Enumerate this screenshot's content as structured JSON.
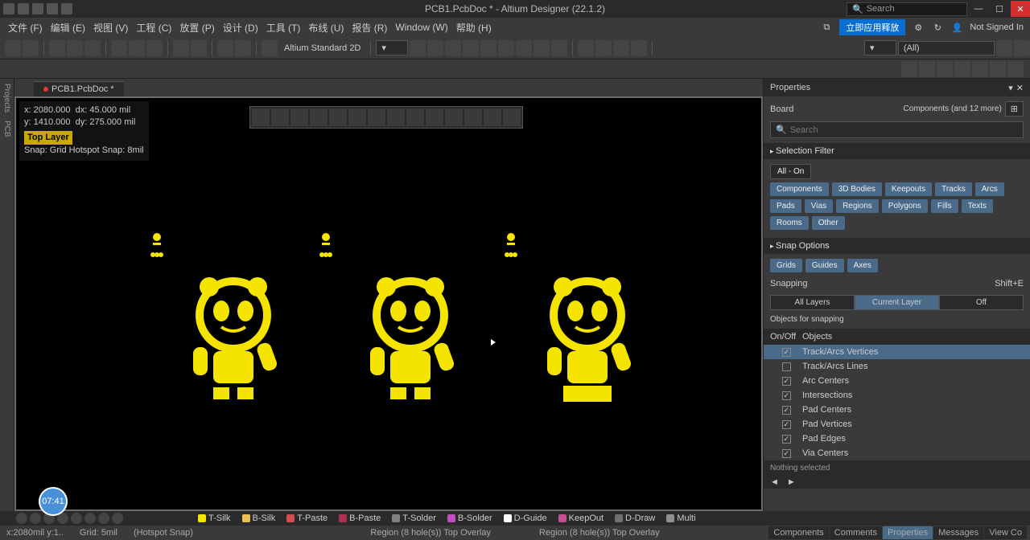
{
  "titlebar": {
    "title": "PCB1.PcbDoc * - Altium Designer (22.1.2)",
    "search_placeholder": "Search"
  },
  "menubar": {
    "items": [
      "文件 (F)",
      "编辑 (E)",
      "视图 (V)",
      "工程 (C)",
      "放置 (P)",
      "设计 (D)",
      "工具 (T)",
      "布线 (U)",
      "报告 (R)",
      "Window (W)",
      "帮助 (H)"
    ],
    "banner": "立即应用释放",
    "signin": "Not Signed In"
  },
  "toolbar": {
    "view_mode": "Altium Standard 2D",
    "net_filter": "(All)"
  },
  "doc_tab": "PCB1.PcbDoc *",
  "coords": {
    "x_label": "x:",
    "x_val": "2080.000",
    "dx_label": "dx:",
    "dx_val": "45.000 mil",
    "y_label": "y:",
    "y_val": "1410.000",
    "dy_label": "dy:",
    "dy_val": "275.000 mil",
    "layer": "Top Layer",
    "snap_info": "Snap: Grid Hotspot Snap: 8mil"
  },
  "properties": {
    "title": "Properties",
    "object_type": "Board",
    "object_filter": "Components (and 12 more)",
    "search_placeholder": "Search",
    "selection_filter": {
      "title": "Selection Filter",
      "all_on": "All - On",
      "pills": [
        "Components",
        "3D Bodies",
        "Keepouts",
        "Tracks",
        "Arcs",
        "Pads",
        "Vias",
        "Regions",
        "Polygons",
        "Fills",
        "Texts",
        "Rooms",
        "Other"
      ]
    },
    "snap_options": {
      "title": "Snap Options",
      "pills": [
        "Grids",
        "Guides",
        "Axes"
      ],
      "snapping_label": "Snapping",
      "snapping_shortcut": "Shift+E",
      "segs": [
        "All Layers",
        "Current Layer",
        "Off"
      ],
      "active_seg": 1,
      "objects_label": "Objects for snapping",
      "col_onoff": "On/Off",
      "col_objects": "Objects",
      "rows": [
        {
          "on": true,
          "label": "Track/Arcs Vertices",
          "selected": true
        },
        {
          "on": false,
          "label": "Track/Arcs Lines"
        },
        {
          "on": true,
          "label": "Arc Centers"
        },
        {
          "on": true,
          "label": "Intersections"
        },
        {
          "on": true,
          "label": "Pad Centers"
        },
        {
          "on": true,
          "label": "Pad Vertices"
        },
        {
          "on": true,
          "label": "Pad Edges"
        },
        {
          "on": true,
          "label": "Via Centers"
        }
      ]
    },
    "nothing_selected": "Nothing selected"
  },
  "layer_tabs": [
    {
      "color": "#f5e400",
      "label": "T-Silk"
    },
    {
      "color": "#e8c050",
      "label": "B-Silk"
    },
    {
      "color": "#d05050",
      "label": "T-Paste"
    },
    {
      "color": "#b03050",
      "label": "B-Paste"
    },
    {
      "color": "#808080",
      "label": "T-Solder"
    },
    {
      "color": "#c050c0",
      "label": "B-Solder"
    },
    {
      "color": "#ffffff",
      "label": "D-Guide"
    },
    {
      "color": "#c05090",
      "label": "KeepOut"
    },
    {
      "color": "#707070",
      "label": "D-Draw"
    },
    {
      "color": "#909090",
      "label": "Multi"
    }
  ],
  "statusbar": {
    "left": [
      "x:2080mil y:1..",
      "Grid: 5mil",
      "(Hotspot Snap)"
    ],
    "center1": "Region (8 hole(s)) Top Overlay",
    "center2": "Region (8 hole(s)) Top Overlay",
    "right_tabs": [
      "Components",
      "Comments",
      "Properties",
      "Messages",
      "View Co"
    ]
  },
  "bubble": "07:41"
}
